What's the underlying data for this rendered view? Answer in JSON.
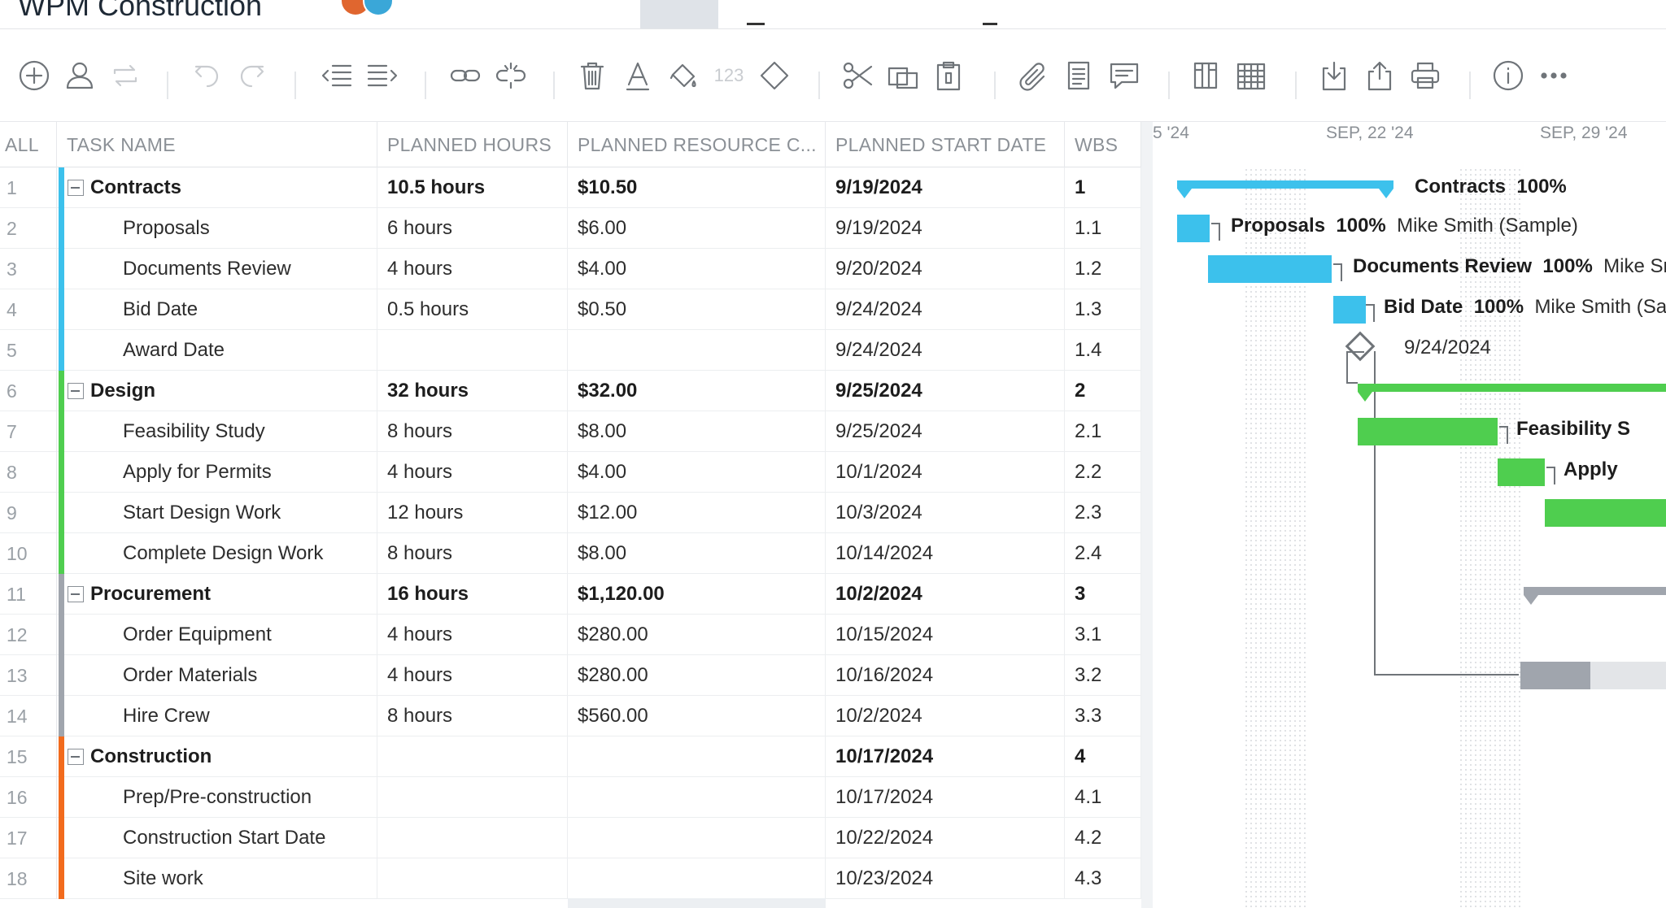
{
  "app": {
    "project_title": "WPM Construction",
    "colors": {
      "contracts": "#3cc1ec",
      "design": "#4fce4f",
      "procurement": "#a0a5ad",
      "construction": "#f26b1d"
    }
  },
  "toolbar": {
    "buttons": [
      {
        "icon": "add-task-icon",
        "enabled": true
      },
      {
        "icon": "add-user-icon",
        "enabled": true
      },
      {
        "icon": "recurring-icon",
        "enabled": false
      },
      {
        "icon": "undo-icon",
        "enabled": false
      },
      {
        "icon": "redo-icon",
        "enabled": false
      },
      {
        "icon": "outdent-icon",
        "enabled": true
      },
      {
        "icon": "indent-icon",
        "enabled": true
      },
      {
        "icon": "link-icon",
        "enabled": true
      },
      {
        "icon": "unlink-icon",
        "enabled": true
      },
      {
        "icon": "delete-icon",
        "enabled": true
      },
      {
        "icon": "text-format-icon",
        "enabled": true
      },
      {
        "icon": "paint-bucket-icon",
        "enabled": true
      },
      {
        "icon": "numbering-icon",
        "enabled": false
      },
      {
        "icon": "milestone-icon",
        "enabled": true
      },
      {
        "icon": "cut-icon",
        "enabled": true
      },
      {
        "icon": "copy-icon",
        "enabled": true
      },
      {
        "icon": "paste-icon",
        "enabled": true
      },
      {
        "icon": "attachment-icon",
        "enabled": true
      },
      {
        "icon": "notes-icon",
        "enabled": true
      },
      {
        "icon": "comment-icon",
        "enabled": true
      },
      {
        "icon": "columns-icon",
        "enabled": true
      },
      {
        "icon": "table-icon",
        "enabled": true
      },
      {
        "icon": "import-icon",
        "enabled": true
      },
      {
        "icon": "export-icon",
        "enabled": true
      },
      {
        "icon": "print-icon",
        "enabled": true
      },
      {
        "icon": "info-icon",
        "enabled": true
      },
      {
        "icon": "more-icon",
        "enabled": true
      }
    ],
    "numbering_label": "123"
  },
  "grid": {
    "headers": {
      "all": "ALL",
      "task_name": "TASK NAME",
      "planned_hours": "PLANNED HOURS",
      "planned_cost": "PLANNED RESOURCE C...",
      "planned_start": "PLANNED START DATE",
      "wbs": "WBS"
    },
    "rows": [
      {
        "num": "1",
        "name": "Contracts",
        "hours": "10.5 hours",
        "cost": "$10.50",
        "start": "9/19/2024",
        "wbs": "1",
        "parent": true,
        "group": "contracts"
      },
      {
        "num": "2",
        "name": "Proposals",
        "hours": "6 hours",
        "cost": "$6.00",
        "start": "9/19/2024",
        "wbs": "1.1",
        "parent": false,
        "group": "contracts"
      },
      {
        "num": "3",
        "name": "Documents Review",
        "hours": "4 hours",
        "cost": "$4.00",
        "start": "9/20/2024",
        "wbs": "1.2",
        "parent": false,
        "group": "contracts"
      },
      {
        "num": "4",
        "name": "Bid Date",
        "hours": "0.5 hours",
        "cost": "$0.50",
        "start": "9/24/2024",
        "wbs": "1.3",
        "parent": false,
        "group": "contracts"
      },
      {
        "num": "5",
        "name": "Award Date",
        "hours": "",
        "cost": "",
        "start": "9/24/2024",
        "wbs": "1.4",
        "parent": false,
        "group": "contracts"
      },
      {
        "num": "6",
        "name": "Design",
        "hours": "32 hours",
        "cost": "$32.00",
        "start": "9/25/2024",
        "wbs": "2",
        "parent": true,
        "group": "design"
      },
      {
        "num": "7",
        "name": "Feasibility Study",
        "hours": "8 hours",
        "cost": "$8.00",
        "start": "9/25/2024",
        "wbs": "2.1",
        "parent": false,
        "group": "design"
      },
      {
        "num": "8",
        "name": "Apply for Permits",
        "hours": "4 hours",
        "cost": "$4.00",
        "start": "10/1/2024",
        "wbs": "2.2",
        "parent": false,
        "group": "design"
      },
      {
        "num": "9",
        "name": "Start Design Work",
        "hours": "12 hours",
        "cost": "$12.00",
        "start": "10/3/2024",
        "wbs": "2.3",
        "parent": false,
        "group": "design"
      },
      {
        "num": "10",
        "name": "Complete Design Work",
        "hours": "8 hours",
        "cost": "$8.00",
        "start": "10/14/2024",
        "wbs": "2.4",
        "parent": false,
        "group": "design"
      },
      {
        "num": "11",
        "name": "Procurement",
        "hours": "16 hours",
        "cost": "$1,120.00",
        "start": "10/2/2024",
        "wbs": "3",
        "parent": true,
        "group": "procurement"
      },
      {
        "num": "12",
        "name": "Order Equipment",
        "hours": "4 hours",
        "cost": "$280.00",
        "start": "10/15/2024",
        "wbs": "3.1",
        "parent": false,
        "group": "procurement"
      },
      {
        "num": "13",
        "name": "Order Materials",
        "hours": "4 hours",
        "cost": "$280.00",
        "start": "10/16/2024",
        "wbs": "3.2",
        "parent": false,
        "group": "procurement"
      },
      {
        "num": "14",
        "name": "Hire Crew",
        "hours": "8 hours",
        "cost": "$560.00",
        "start": "10/2/2024",
        "wbs": "3.3",
        "parent": false,
        "group": "procurement"
      },
      {
        "num": "15",
        "name": "Construction",
        "hours": "",
        "cost": "",
        "start": "10/17/2024",
        "wbs": "4",
        "parent": true,
        "group": "construction"
      },
      {
        "num": "16",
        "name": "Prep/Pre-construction",
        "hours": "",
        "cost": "",
        "start": "10/17/2024",
        "wbs": "4.1",
        "parent": false,
        "group": "construction"
      },
      {
        "num": "17",
        "name": "Construction Start Date",
        "hours": "",
        "cost": "",
        "start": "10/22/2024",
        "wbs": "4.2",
        "parent": false,
        "group": "construction"
      },
      {
        "num": "18",
        "name": "Site work",
        "hours": "",
        "cost": "",
        "start": "10/23/2024",
        "wbs": "4.3",
        "parent": false,
        "group": "construction"
      }
    ]
  },
  "gantt": {
    "dates": [
      "5 '24",
      "SEP, 22 '24",
      "SEP, 29 '24"
    ],
    "labels": {
      "contracts": {
        "name": "Contracts",
        "pct": "100%"
      },
      "proposals": {
        "name": "Proposals",
        "pct": "100%",
        "assignee": "Mike Smith (Sample)"
      },
      "documents_review": {
        "name": "Documents Review",
        "pct": "100%",
        "assignee": "Mike Sm"
      },
      "bid_date": {
        "name": "Bid Date",
        "pct": "100%",
        "assignee": "Mike Smith (Sa"
      },
      "award_date": {
        "date": "9/24/2024"
      },
      "feasibility": {
        "name": "Feasibility S"
      },
      "permits": {
        "name": "Apply"
      }
    }
  }
}
